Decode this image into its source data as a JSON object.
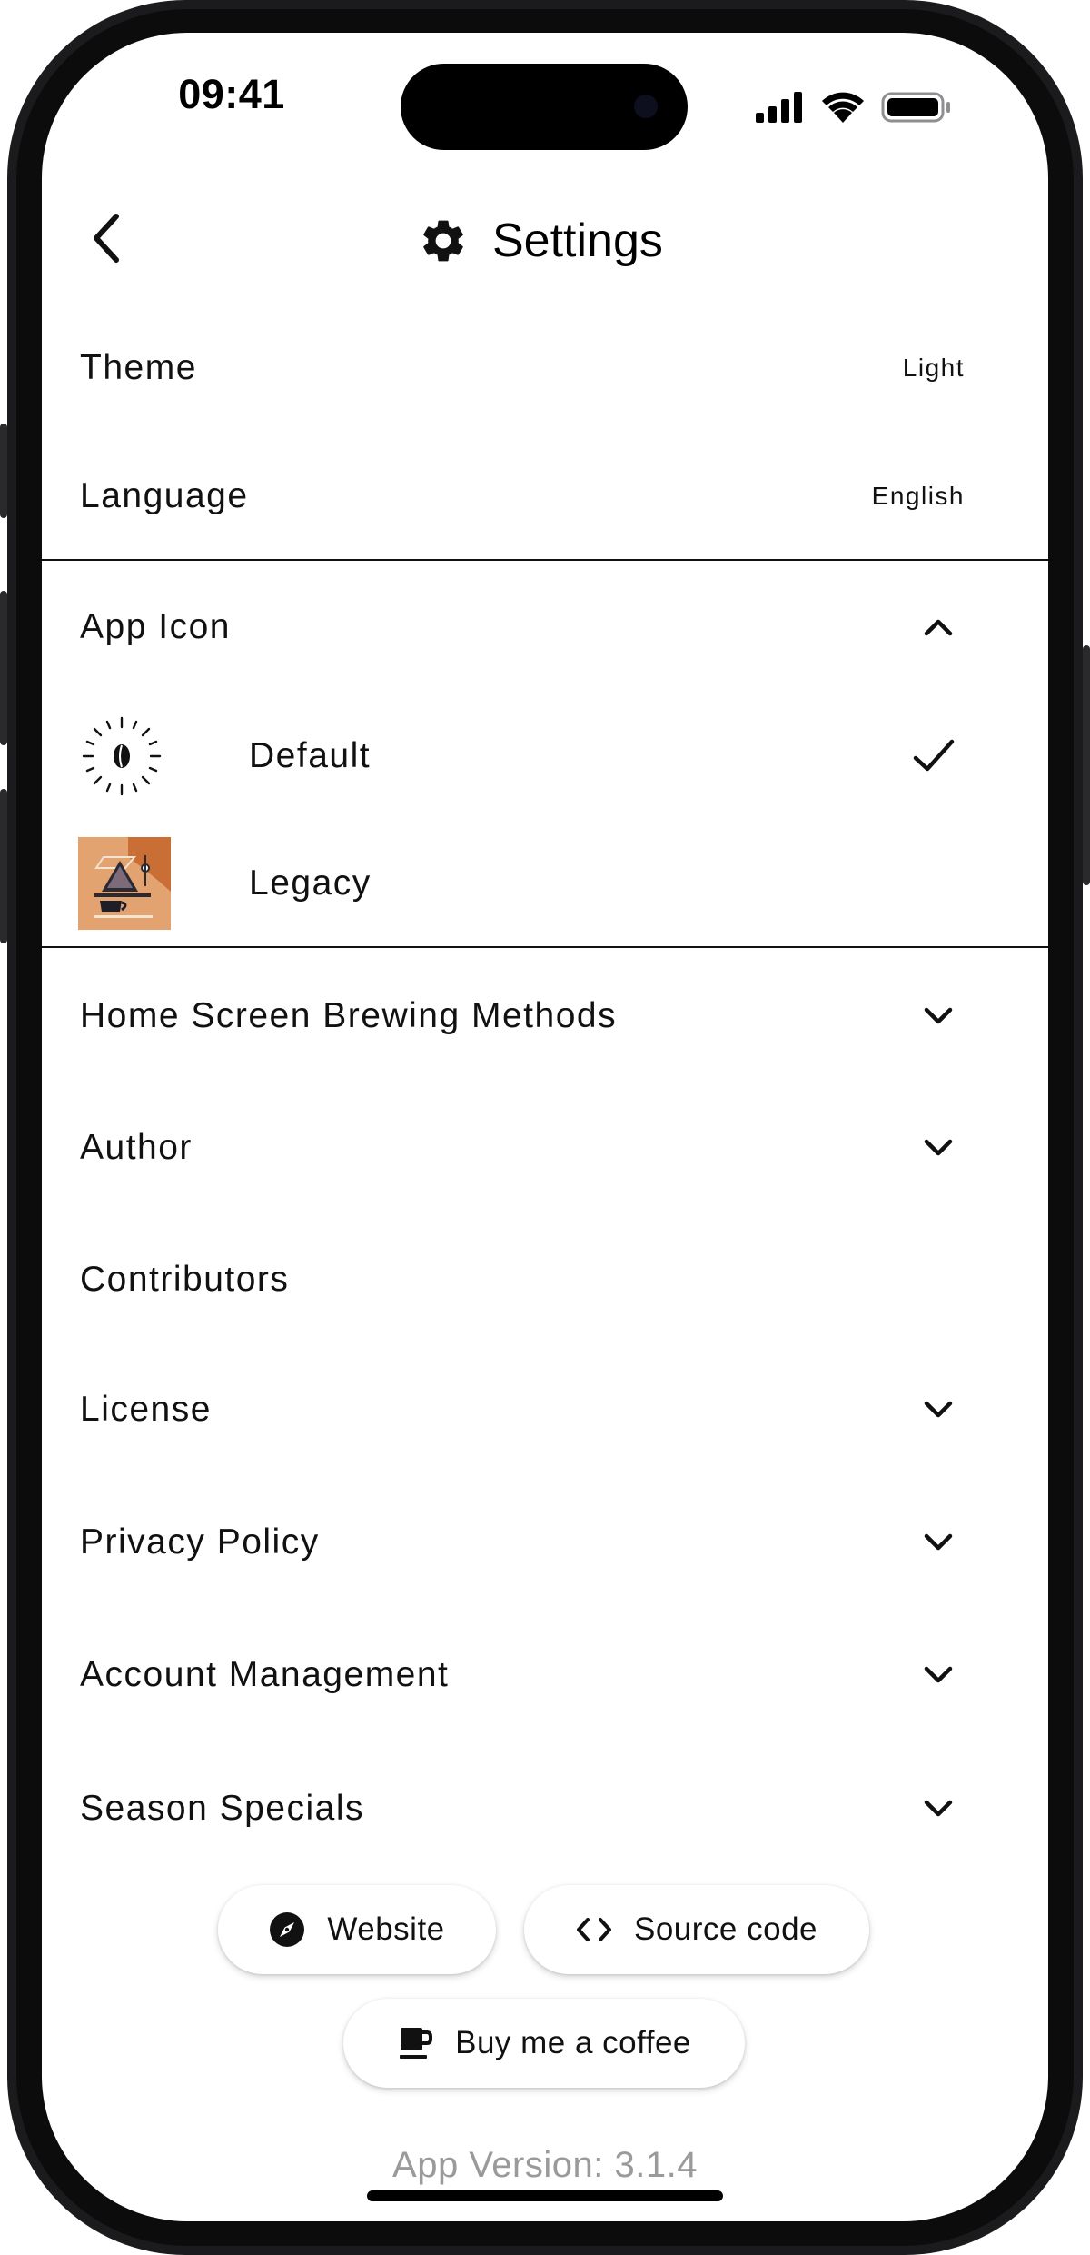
{
  "status_bar": {
    "time": "09:41",
    "icons": [
      "cellular-signal-icon",
      "wifi-icon",
      "battery-icon"
    ]
  },
  "nav": {
    "title": "Settings",
    "title_icon": "gear-icon",
    "back_icon": "chevron-left-icon"
  },
  "settings": {
    "theme": {
      "label": "Theme",
      "value": "Light"
    },
    "language": {
      "label": "Language",
      "value": "English"
    },
    "app_icon": {
      "label": "App Icon",
      "expanded": true,
      "options": [
        {
          "label": "Default",
          "selected": true,
          "icon": "coffee-bean-sun-icon"
        },
        {
          "label": "Legacy",
          "selected": false,
          "icon": "legacy-brewing-icon"
        }
      ]
    },
    "rows": [
      {
        "label": "Home Screen Brewing Methods",
        "expandable": true
      },
      {
        "label": "Author",
        "expandable": true
      },
      {
        "label": "Contributors",
        "expandable": false
      },
      {
        "label": "License",
        "expandable": true
      },
      {
        "label": "Privacy Policy",
        "expandable": true
      },
      {
        "label": "Account Management",
        "expandable": true
      },
      {
        "label": "Season Specials",
        "expandable": true
      }
    ]
  },
  "links": {
    "website": {
      "label": "Website",
      "icon": "compass-icon"
    },
    "source_code": {
      "label": "Source code",
      "icon": "code-icon"
    },
    "coffee": {
      "label": "Buy me a coffee",
      "icon": "coffee-cup-icon"
    }
  },
  "footer": {
    "version": "App Version: 3.1.4"
  },
  "colors": {
    "text": "#111111",
    "muted": "#9a9a9a",
    "frame": "#1b1b1d",
    "legacy_icon_bg": "#e3a370",
    "legacy_icon_accent": "#c96f35"
  }
}
